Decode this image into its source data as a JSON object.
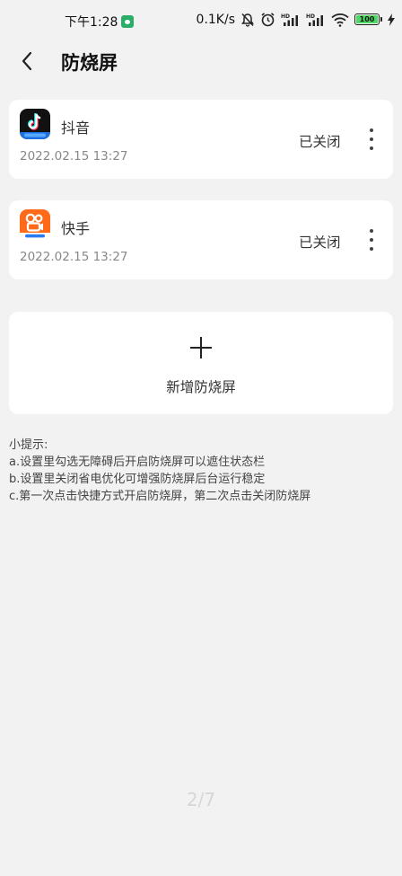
{
  "status_bar": {
    "time": "下午1:28",
    "network_speed": "0.1K/s",
    "battery": "100",
    "accent": "#4cd964"
  },
  "header": {
    "title": "防烧屏"
  },
  "apps": [
    {
      "name": "抖音",
      "date": "2022.02.15 13:27",
      "status": "已关闭",
      "icon": "douyin-app-icon"
    },
    {
      "name": "快手",
      "date": "2022.02.15 13:27",
      "status": "已关闭",
      "icon": "kuaishou-app-icon"
    }
  ],
  "add": {
    "label": "新增防烧屏"
  },
  "tips": {
    "title": "小提示:",
    "a": "a.设置里勾选无障碍后开启防烧屏可以遮住状态栏",
    "b": "b.设置里关闭省电优化可增强防烧屏后台运行稳定",
    "c": "c.第一次点击快捷方式开启防烧屏，第二次点击关闭防烧屏"
  },
  "pager": {
    "text": "2/7"
  }
}
